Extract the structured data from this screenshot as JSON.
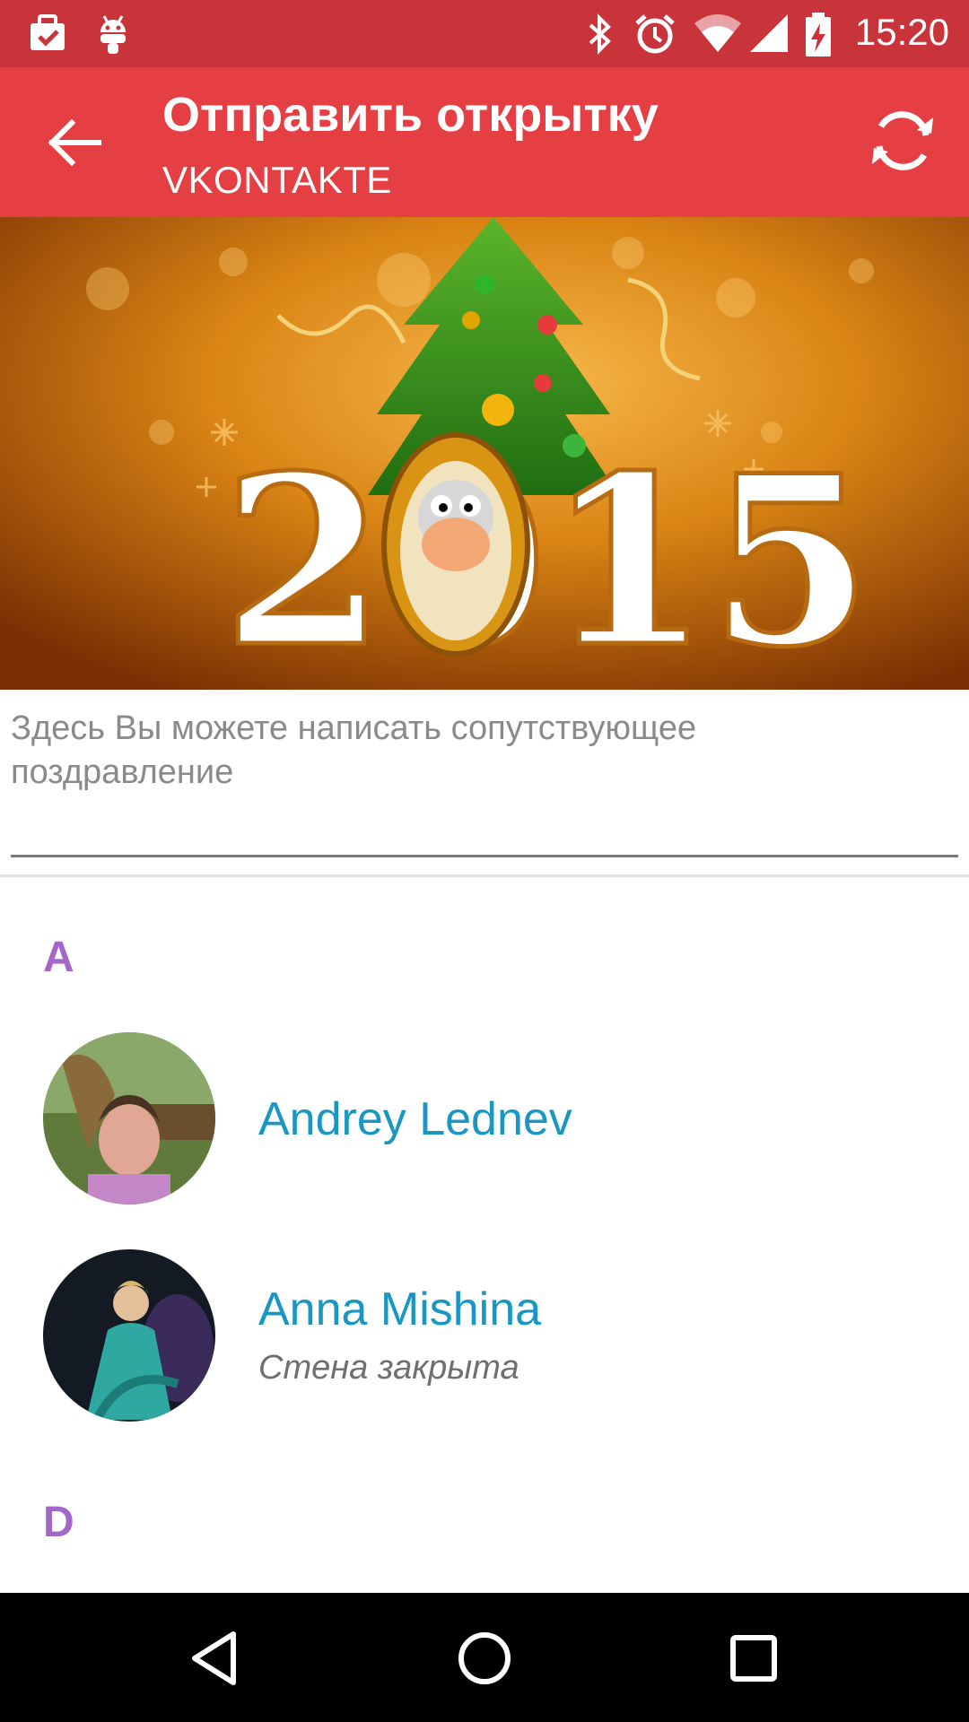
{
  "status_bar": {
    "time": "15:20",
    "left_icons": [
      "task-icon",
      "android-icon"
    ],
    "right_icons": [
      "bluetooth-icon",
      "alarm-icon",
      "wifi-icon",
      "signal-icon",
      "battery-charging-icon"
    ]
  },
  "app_bar": {
    "title": "Отправить открытку",
    "subtitle": "VKONTAKTE",
    "back_icon": "arrow-back-icon",
    "refresh_icon": "refresh-icon",
    "color": "#e53f44"
  },
  "card": {
    "year_text": "2015"
  },
  "message": {
    "placeholder": "Здесь Вы можете написать сопутствующее поздравление",
    "value": ""
  },
  "contacts": {
    "sections": [
      {
        "letter": "A",
        "items": [
          {
            "name": "Andrey Lednev",
            "status": ""
          },
          {
            "name": "Anna Mishina",
            "status": "Стена закрыта"
          }
        ]
      },
      {
        "letter": "D",
        "items": []
      }
    ],
    "header_color": "#a566c9",
    "name_color": "#1a96c3"
  },
  "nav_bar": {
    "icons": [
      "back-triangle-icon",
      "home-circle-icon",
      "recents-square-icon"
    ]
  }
}
